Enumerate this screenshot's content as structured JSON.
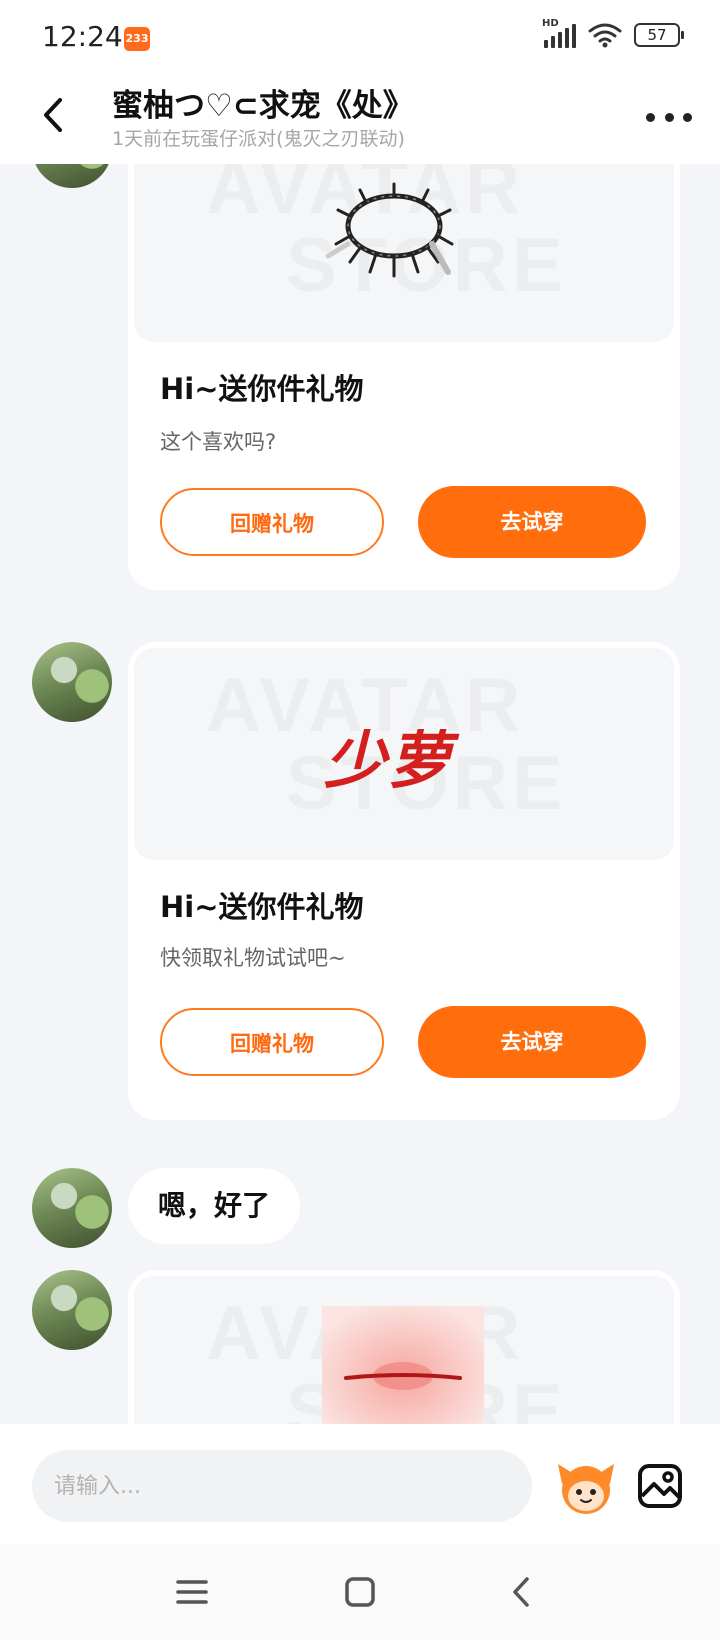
{
  "status_bar": {
    "time": "12:24",
    "app_badge": "233",
    "network_label": "HD",
    "battery": "57"
  },
  "header": {
    "title": "蜜柚つ♡⊂求宠《处》",
    "subtitle": "1天前在玩蛋仔派对(鬼灭之刃联动)"
  },
  "messages": [
    {
      "type": "gift",
      "item_name": "necklace-item-icon",
      "watermark_line1": "AVATAR",
      "watermark_line2": "STORE",
      "title": "Hi~送你件礼物",
      "subtitle": "这个喜欢吗?",
      "return_label": "回赠礼物",
      "try_label": "去试穿"
    },
    {
      "type": "gift",
      "item_name": "calligraphy-item",
      "item_text": "少萝",
      "watermark_line1": "AVATAR",
      "watermark_line2": "STORE",
      "title": "Hi~送你件礼物",
      "subtitle": "快领取礼物试试吧~",
      "return_label": "回赠礼物",
      "try_label": "去试穿"
    },
    {
      "type": "text",
      "text": "嗯，好了"
    },
    {
      "type": "gift",
      "item_name": "lips-item-icon",
      "watermark_line1": "AVATAR",
      "watermark_line2": "STORE"
    }
  ],
  "input": {
    "placeholder": "请输入..."
  },
  "colors": {
    "accent": "#ff6d0d",
    "background": "#f3f5f8",
    "card": "#ffffff"
  }
}
